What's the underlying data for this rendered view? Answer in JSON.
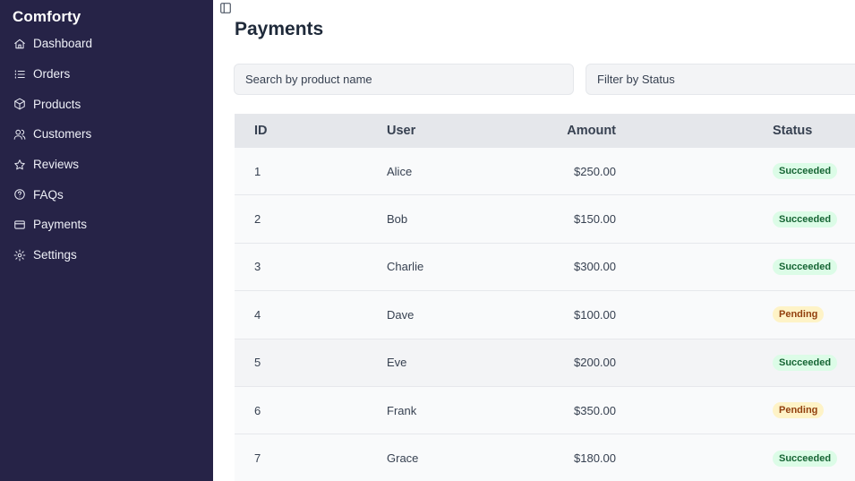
{
  "brand": "Comforty",
  "sidebar": {
    "items": [
      {
        "label": "Dashboard",
        "icon": "home-icon"
      },
      {
        "label": "Orders",
        "icon": "list-icon"
      },
      {
        "label": "Products",
        "icon": "box-icon"
      },
      {
        "label": "Customers",
        "icon": "users-icon"
      },
      {
        "label": "Reviews",
        "icon": "star-icon"
      },
      {
        "label": "FAQs",
        "icon": "help-circle-icon"
      },
      {
        "label": "Payments",
        "icon": "credit-card-icon"
      },
      {
        "label": "Settings",
        "icon": "gear-icon"
      }
    ]
  },
  "page": {
    "title": "Payments",
    "search_placeholder": "Search by product name",
    "filter_label": "Filter by Status"
  },
  "table": {
    "headers": {
      "id": "ID",
      "user": "User",
      "amount": "Amount",
      "status": "Status"
    },
    "rows": [
      {
        "id": "1",
        "user": "Alice",
        "amount": "$250.00",
        "status": "Succeeded"
      },
      {
        "id": "2",
        "user": "Bob",
        "amount": "$150.00",
        "status": "Succeeded"
      },
      {
        "id": "3",
        "user": "Charlie",
        "amount": "$300.00",
        "status": "Succeeded"
      },
      {
        "id": "4",
        "user": "Dave",
        "amount": "$100.00",
        "status": "Pending"
      },
      {
        "id": "5",
        "user": "Eve",
        "amount": "$200.00",
        "status": "Succeeded"
      },
      {
        "id": "6",
        "user": "Frank",
        "amount": "$350.00",
        "status": "Pending"
      },
      {
        "id": "7",
        "user": "Grace",
        "amount": "$180.00",
        "status": "Succeeded"
      }
    ]
  },
  "colors": {
    "sidebar_bg": "#262347",
    "succeeded_bg": "#dcfce7",
    "succeeded_text": "#166534",
    "pending_bg": "#fef3c7",
    "pending_text": "#92400e"
  }
}
